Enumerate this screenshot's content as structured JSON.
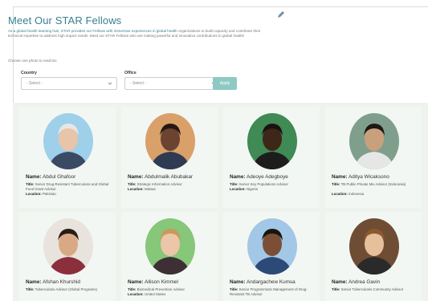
{
  "page": {
    "title": "Meet Our STAR Fellows",
    "intro_lead": "As a global health learning hub, STAR provides our Fellows with immersive experiences in global health",
    "intro_rest": " organizations to build capacity and contribute their technical expertise to address high impact needs. Meet our STAR Fellows who are making powerful and innovative contributions to global health!",
    "choose_text": "Choose one photo to read bio",
    "edit_icon": "pencil-icon"
  },
  "filters": {
    "country_label": "Country",
    "country_value": "- Select -",
    "office_label": "Office",
    "office_value": "- Select -",
    "apply_label": "Apply"
  },
  "fellows": [
    {
      "name_label": "Name:",
      "name": "Abdul Ghafoor",
      "title_label": "Title:",
      "title": "Senior Drug-Resistant Tuberculosis and Global Fund Grant Advisor",
      "location_label": "Location:",
      "location": "Pakistan",
      "bg": "#9fd0ea",
      "skin": "#e8c4a8",
      "hair": "#e6e6e6",
      "shirt": "#3b4a63"
    },
    {
      "name_label": "Name:",
      "name": "Abdulmalik Abubakar",
      "title_label": "Title:",
      "title": "Strategic Information Advisor",
      "location_label": "Location:",
      "location": "Malawi",
      "bg": "#d9a06a",
      "skin": "#6b4330",
      "hair": "#241812",
      "shirt": "#2f3b52"
    },
    {
      "name_label": "Name:",
      "name": "Adeoye Adegboye",
      "title_label": "Title:",
      "title": "Senior Key Populations Advisor",
      "location_label": "Location:",
      "location": "Nigeria",
      "bg": "#3f8a55",
      "skin": "#3e2618",
      "hair": "#1a1210",
      "shirt": "#1d1d1d"
    },
    {
      "name_label": "Name:",
      "name": "Aditya Wicaksono",
      "title_label": "Title:",
      "title": "TB Public-Private Mix Advisor (Indonesia)",
      "location_label": "Location:",
      "location": "Indonesia",
      "bg": "#7f9f8c",
      "skin": "#c9a07e",
      "hair": "#1e1712",
      "shirt": "#e6e6e6"
    },
    {
      "name_label": "Name:",
      "name": "Afshan Khurshid",
      "title_label": "Title:",
      "title": "Tuberculosis Advisor (Global Programs)",
      "location_label": "Location:",
      "location": "",
      "bg": "#e8e3dc",
      "skin": "#d9a985",
      "hair": "#2a1c16",
      "shirt": "#8c2f3c"
    },
    {
      "name_label": "Name:",
      "name": "Allison Kimmel",
      "title_label": "Title:",
      "title": "Biomedical Prevention Advisor",
      "location_label": "Location:",
      "location": "United States",
      "bg": "#86c77a",
      "skin": "#ecc6a9",
      "hair": "#c89a5c",
      "shirt": "#3d2f35"
    },
    {
      "name_label": "Name:",
      "name": "Andargachew Kumsa",
      "title_label": "Title:",
      "title": "Senior Programmatic Management of Drug-Resistant TB Advisor",
      "location_label": "Location:",
      "location": "",
      "bg": "#a3c7e6",
      "skin": "#7a4f35",
      "hair": "#1a1410",
      "shirt": "#2b4a77"
    },
    {
      "name_label": "Name:",
      "name": "Andrea Gavin",
      "title_label": "Title:",
      "title": "Senior Tuberculosis Community Advisor",
      "location_label": "Location:",
      "location": "",
      "bg": "#6e4d34",
      "skin": "#e6bf9d",
      "hair": "#8a5a2e",
      "shirt": "#2a2a2a"
    }
  ]
}
